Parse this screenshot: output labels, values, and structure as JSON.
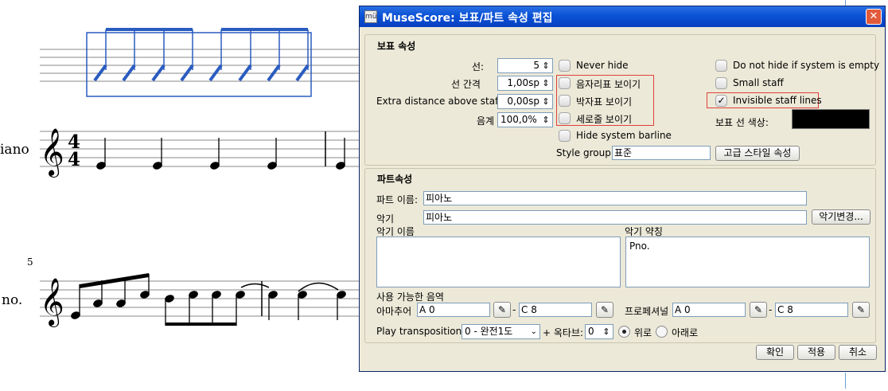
{
  "score": {
    "staff1_name": "iano",
    "staff2_name": "no.",
    "time_sig_top": "4",
    "time_sig_bottom": "4",
    "measure_number": "5"
  },
  "dialog": {
    "title": "MuseScore: 보표/파트 속성 편집",
    "staff_group": {
      "title": "보표 속성",
      "lines_label": "선:",
      "lines_value": "5",
      "spacing_label": "선 간격",
      "spacing_value": "1,00sp",
      "extra_distance_label": "Extra distance above staff:",
      "extra_distance_value": "0,00sp",
      "scale_label": "음계",
      "scale_value": "100,0%",
      "never_hide": "Never hide",
      "show_clef": "음자리표 보이기",
      "show_timesig": "박자표 보이기",
      "show_barlines": "세로줄 보이기",
      "hide_system_barline": "Hide system barline",
      "no_hide_if_empty": "Do not hide if system is empty",
      "small_staff": "Small staff",
      "invisible_lines": "Invisible staff lines",
      "invisible_lines_checked": true,
      "line_color_label": "보표 선 색상:",
      "line_color": "#000000",
      "style_group_label": "Style group:",
      "style_group_value": "표준",
      "advanced_button": "고급 스타일 속성"
    },
    "part_group": {
      "title": "파트속성",
      "part_name_label": "파트 이름:",
      "part_name_value": "피아노",
      "instrument_label": "악기",
      "instrument_value": "피아노",
      "change_instrument_button": "악기변경...",
      "long_name_label": "악기 이름",
      "short_name_label": "악기 약칭",
      "short_name_value": "Pno.",
      "usable_range_label": "사용 가능한 음역",
      "amateur_label": "아마추어",
      "amateur_low": "A 0",
      "amateur_high": "C 8",
      "professional_label": "프로페셔널",
      "pro_low": "A 0",
      "pro_high": "C 8",
      "transposition_label": "Play transposition:",
      "transposition_value": "0 - 완전1도",
      "octave_label": "+ 옥타브:",
      "octave_value": "0",
      "up_label": "위로",
      "down_label": "아래로"
    },
    "ok_button": "확인",
    "apply_button": "적용",
    "cancel_button": "취소"
  }
}
